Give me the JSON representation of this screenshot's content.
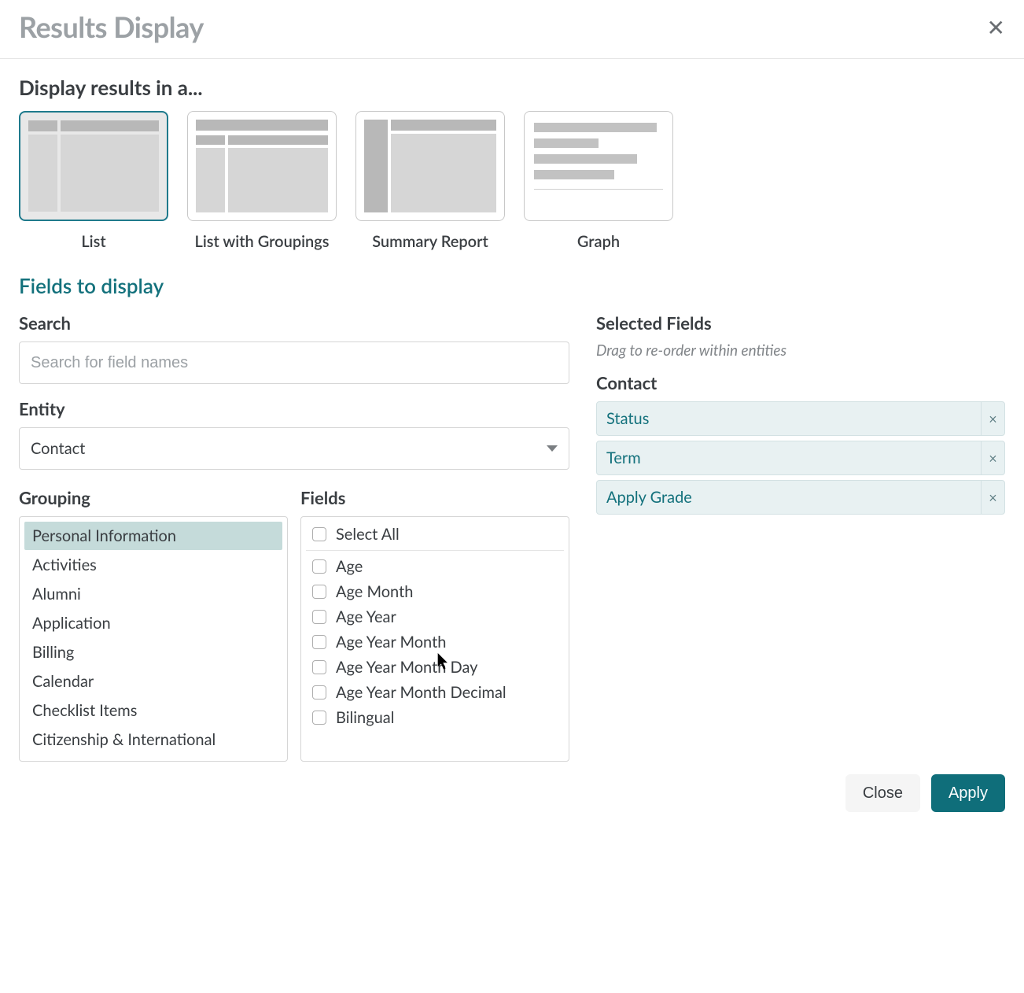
{
  "modal": {
    "title": "Results Display"
  },
  "display_section": {
    "heading": "Display results in a...",
    "options": [
      {
        "label": "List",
        "selected": true
      },
      {
        "label": "List with Groupings",
        "selected": false
      },
      {
        "label": "Summary Report",
        "selected": false
      },
      {
        "label": "Graph",
        "selected": false
      }
    ]
  },
  "fields_heading": "Fields to display",
  "search": {
    "label": "Search",
    "placeholder": "Search for field names",
    "value": ""
  },
  "entity": {
    "label": "Entity",
    "value": "Contact"
  },
  "grouping": {
    "label": "Grouping",
    "items": [
      {
        "label": "Personal Information",
        "selected": true
      },
      {
        "label": "Activities",
        "selected": false
      },
      {
        "label": "Alumni",
        "selected": false
      },
      {
        "label": "Application",
        "selected": false
      },
      {
        "label": "Billing",
        "selected": false
      },
      {
        "label": "Calendar",
        "selected": false
      },
      {
        "label": "Checklist Items",
        "selected": false
      },
      {
        "label": "Citizenship & International",
        "selected": false
      }
    ]
  },
  "fields": {
    "label": "Fields",
    "select_all_label": "Select All",
    "items": [
      {
        "label": "Age",
        "checked": false
      },
      {
        "label": "Age Month",
        "checked": false
      },
      {
        "label": "Age Year",
        "checked": false
      },
      {
        "label": "Age Year Month",
        "checked": false
      },
      {
        "label": "Age Year Month Day",
        "checked": false
      },
      {
        "label": "Age Year Month Decimal",
        "checked": false
      },
      {
        "label": "Bilingual",
        "checked": false
      }
    ]
  },
  "selected": {
    "heading": "Selected Fields",
    "hint": "Drag to re-order within entities",
    "entity_heading": "Contact",
    "items": [
      {
        "label": "Status"
      },
      {
        "label": "Term"
      },
      {
        "label": "Apply Grade"
      }
    ]
  },
  "footer": {
    "close": "Close",
    "apply": "Apply"
  }
}
